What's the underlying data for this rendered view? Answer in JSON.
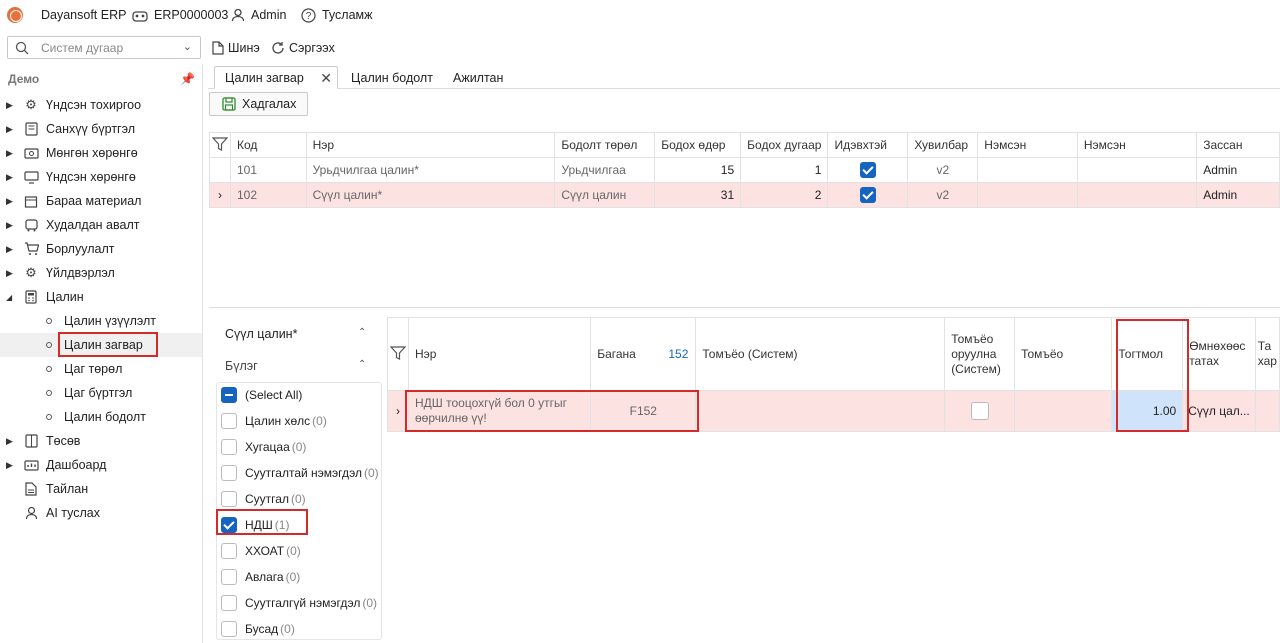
{
  "app": {
    "name": "Dayansoft ERP",
    "company": "ERP0000003",
    "user": "Admin",
    "help": "Тусламж"
  },
  "toolbar": {
    "search_placeholder": "Систем дугаар",
    "new_label": "Шинэ",
    "refresh_label": "Сэргээх"
  },
  "sidebar": {
    "section": "Демо",
    "items": [
      {
        "label": "Үндсэн тохиргоо",
        "icon": "gear-icon"
      },
      {
        "label": "Санхүү бүртгэл",
        "icon": "ledger-icon"
      },
      {
        "label": "Мөнгөн хөрөнгө",
        "icon": "cash-icon"
      },
      {
        "label": "Үндсэн хөрөнгө",
        "icon": "monitor-icon"
      },
      {
        "label": "Бараа материал",
        "icon": "box-icon"
      },
      {
        "label": "Худалдан авалт",
        "icon": "truck-icon"
      },
      {
        "label": "Борлуулалт",
        "icon": "cart-icon"
      },
      {
        "label": "Үйлдвэрлэл",
        "icon": "factory-icon"
      },
      {
        "label": "Цалин",
        "icon": "calculator-icon"
      }
    ],
    "sub_items": [
      {
        "label": "Цалин үзүүлэлт"
      },
      {
        "label": "Цалин загвар"
      },
      {
        "label": "Цаг төрөл"
      },
      {
        "label": "Цаг бүртгэл"
      },
      {
        "label": "Цалин бодолт"
      }
    ],
    "bottom_items": [
      {
        "label": "Төсөв",
        "icon": "budget-icon"
      },
      {
        "label": "Дашбоард",
        "icon": "dashboard-icon"
      },
      {
        "label": "Тайлан",
        "icon": "report-icon"
      },
      {
        "label": "AI туслах",
        "icon": "ai-icon"
      }
    ]
  },
  "tabs": [
    {
      "label": "Цалин загвар",
      "active": true
    },
    {
      "label": "Цалин бодолт"
    },
    {
      "label": "Ажилтан"
    }
  ],
  "save_label": "Хадгалах",
  "upper_grid": {
    "headers": [
      "Код",
      "Нэр",
      "Бодолт төрөл",
      "Бодох өдөр",
      "Бодох дугаар",
      "Идэвхтэй",
      "Хувилбар",
      "Нэмсэн",
      "Нэмсэн",
      "Зассан"
    ],
    "rows": [
      {
        "code": "101",
        "name": "Урьдчилгаа цалин*",
        "type": "Урьдчилгаа",
        "day": "15",
        "num": "1",
        "active": true,
        "version": "v2",
        "added1": "",
        "added2": "",
        "edited": "Admin"
      },
      {
        "code": "102",
        "name": "Сүүл цалин*",
        "type": "Сүүл цалин",
        "day": "31",
        "num": "2",
        "active": true,
        "version": "v2",
        "added1": "",
        "added2": "",
        "edited": "Admin"
      }
    ]
  },
  "filter_panel": {
    "title": "Сүүл цалин*",
    "group": "Бүлэг",
    "items": [
      {
        "label": "(Select All)",
        "count": "",
        "state": "indeterminate"
      },
      {
        "label": "Цалин хөлс",
        "count": "(0)",
        "state": "off"
      },
      {
        "label": "Хугацаа",
        "count": "(0)",
        "state": "off"
      },
      {
        "label": "Суутгалтай нэмэгдэл",
        "count": "(0)",
        "state": "off"
      },
      {
        "label": "Суутгал",
        "count": "(0)",
        "state": "off"
      },
      {
        "label": "НДШ",
        "count": "(1)",
        "state": "on"
      },
      {
        "label": "ХХОАТ",
        "count": "(0)",
        "state": "off"
      },
      {
        "label": "Авлага",
        "count": "(0)",
        "state": "off"
      },
      {
        "label": "Суутгалгүй нэмэгдэл",
        "count": "(0)",
        "state": "off"
      },
      {
        "label": "Бусад",
        "count": "(0)",
        "state": "off"
      }
    ]
  },
  "lower_grid": {
    "headers": {
      "name": "Нэр",
      "column": "Багана",
      "column_count": "152",
      "formula_sys": "Томъёо (Систем)",
      "formula_insert": "Томъёо оруулна (Систем)",
      "formula": "Томъёо",
      "constant": "Тогтмол",
      "prev_pull": "Өмнөхөөс татах",
      "next": "Та хар"
    },
    "rows": [
      {
        "name": "НДШ тооцохгүй бол 0 утгыг өөрчилнө үү!",
        "column": "F152",
        "formula_sys": "",
        "formula": "",
        "constant": "1.00",
        "prev_pull": "Сүүл цал..."
      }
    ]
  },
  "colors": {
    "accent": "#1565c0",
    "selected_row": "#fde2e2",
    "highlight_cell": "#cfe3fb",
    "annotation_red": "#d42a2a"
  }
}
